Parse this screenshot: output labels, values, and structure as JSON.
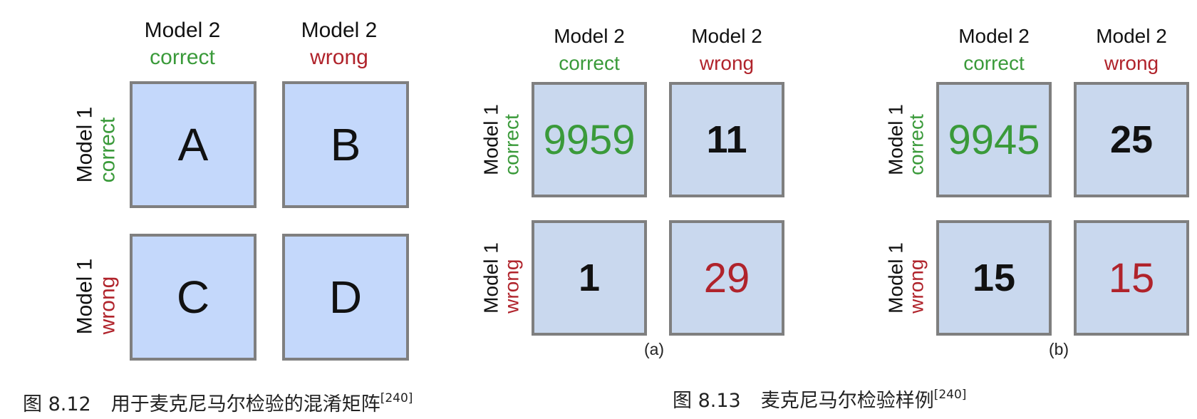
{
  "fig812": {
    "col_headers": [
      {
        "model": "Model 2",
        "label": "correct"
      },
      {
        "model": "Model 2",
        "label": "wrong"
      }
    ],
    "row_headers": [
      {
        "model": "Model 1",
        "label": "correct"
      },
      {
        "model": "Model 1",
        "label": "wrong"
      }
    ],
    "cells": [
      "A",
      "B",
      "C",
      "D"
    ],
    "caption": {
      "fig": "图 8.12",
      "text": "用于麦克尼马尔检验的混淆矩阵",
      "ref": "[240]"
    }
  },
  "fig813": {
    "panels": [
      {
        "sub": "(a)",
        "col_headers": [
          {
            "model": "Model 2",
            "label": "correct"
          },
          {
            "model": "Model 2",
            "label": "wrong"
          }
        ],
        "row_headers": [
          {
            "model": "Model 1",
            "label": "correct"
          },
          {
            "model": "Model 1",
            "label": "wrong"
          }
        ],
        "cells": [
          "9959",
          "11",
          "1",
          "29"
        ]
      },
      {
        "sub": "(b)",
        "col_headers": [
          {
            "model": "Model 2",
            "label": "correct"
          },
          {
            "model": "Model 2",
            "label": "wrong"
          }
        ],
        "row_headers": [
          {
            "model": "Model 1",
            "label": "correct"
          },
          {
            "model": "Model 1",
            "label": "wrong"
          }
        ],
        "cells": [
          "9945",
          "25",
          "15",
          "15"
        ]
      }
    ],
    "caption": {
      "fig": "图 8.13",
      "text": "麦克尼马尔检验样例",
      "ref": "[240]"
    }
  },
  "colors": {
    "correct": "#3a9a3a",
    "wrong": "#b0232b",
    "cell_fill_812": "#c4d8fb",
    "cell_fill_813": "#c9d8ee",
    "border": "#7f7f7f"
  }
}
